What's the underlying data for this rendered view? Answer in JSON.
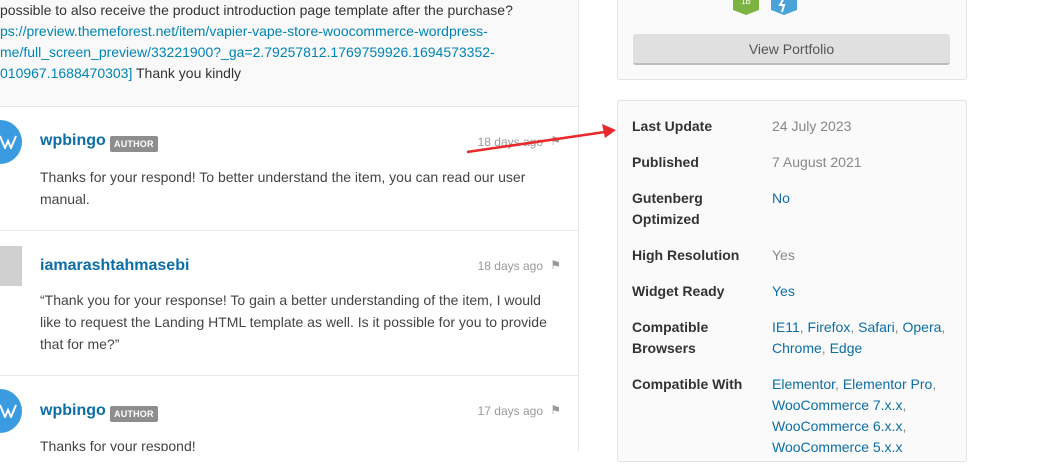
{
  "intro": {
    "line1": " possible to also receive the product introduction page template after the purchase?",
    "link1": "ps://preview.themeforest.net/item/vapier-vape-store-woocommerce-wordpress-",
    "link2": "me/full_screen_preview/33221900?_ga=2.79257812.1769759926.1694573352-",
    "link3": "010967.1688470303]",
    "tail": " Thank you kindly"
  },
  "comments": [
    {
      "user": "wpbingo",
      "badge": "AUTHOR",
      "time": "18 days ago",
      "text": "Thanks for your respond! To better understand the item, you can read our user manual."
    },
    {
      "user": "iamarashtahmasebi",
      "time": "18 days ago",
      "text": "“Thank you for your response! To gain a better understanding of the item, I would like to request the Landing HTML template as well. Is it possible for you to provide that for me?”"
    },
    {
      "user": "wpbingo",
      "badge": "AUTHOR",
      "time": "17 days ago",
      "text": "Thanks for your respond!"
    }
  ],
  "sidebar": {
    "portfolio_button": "View Portfolio",
    "badge1_text": "1B"
  },
  "info": {
    "last_update_label": "Last Update",
    "last_update": "24 July 2023",
    "published_label": "Published",
    "published": "7 August 2021",
    "gutenberg_label1": "Gutenberg",
    "gutenberg_label2": "Optimized",
    "gutenberg": "No",
    "highres_label": "High Resolution",
    "highres": "Yes",
    "widget_label": "Widget Ready",
    "widget": "Yes",
    "browsers_label1": "Compatible",
    "browsers_label2": "Browsers",
    "browsers": [
      "IE11",
      "Firefox",
      "Safari",
      "Opera",
      "Chrome",
      "Edge"
    ],
    "compat_label": "Compatible With",
    "compat": [
      "Elementor",
      "Elementor Pro",
      "WooCommerce 7.x.x",
      "WooCommerce 6.x.x",
      "WooCommerce 5.x.x"
    ]
  },
  "colors": {
    "link": "#0c6ea6",
    "arrow": "#e8282b",
    "avatar": "#3a9be0"
  }
}
